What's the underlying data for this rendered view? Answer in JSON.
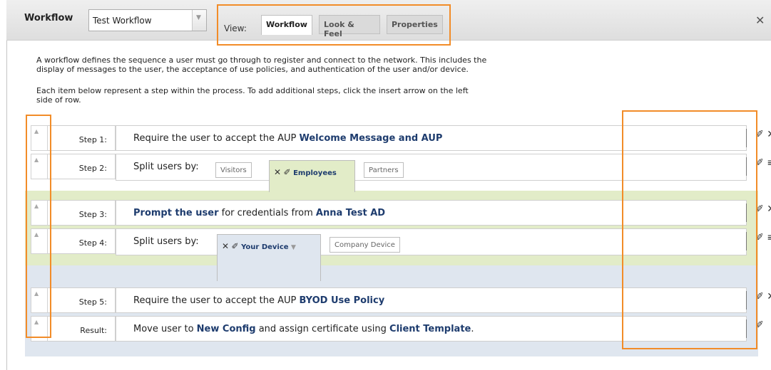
{
  "header": {
    "title": "Workflow",
    "selected_workflow": "Test Workflow",
    "view_label": "View:",
    "tabs": [
      {
        "label": "Workflow",
        "active": true
      },
      {
        "label": "Look & Feel",
        "active": false
      },
      {
        "label": "Properties",
        "active": false
      }
    ]
  },
  "description": {
    "line1": "A workflow defines the sequence a user must go through to register and connect to the network. This includes the",
    "line2": "display of messages to the user, the acceptance of use policies, and authentication of the user and/or device.",
    "line3": "Each item below represent a step within the process. To add additional steps, click the insert arrow on the left",
    "line4": "side of row."
  },
  "steps": [
    {
      "label": "Step 1:",
      "text": "Require the user to accept the AUP ",
      "bold": "Welcome Message and AUP"
    },
    {
      "label": "Step 2:",
      "text": "Split users by:",
      "splits": [
        "Visitors",
        "Employees",
        "Partners"
      ],
      "selected": "Employees"
    },
    {
      "label": "Step 3:",
      "bold1": "Prompt the user",
      "text": " for credentials from ",
      "bold2": "Anna Test AD"
    },
    {
      "label": "Step 4:",
      "text": "Split users by:",
      "splits": [
        "Your Device",
        "Company Device"
      ],
      "selected": "Your Device"
    },
    {
      "label": "Step 5:",
      "text": "Require the user to accept the AUP ",
      "bold": "BYOD Use Policy"
    },
    {
      "label": "Result:",
      "text1": "Move user to ",
      "bold1": "New Config",
      "text2": " and assign certificate using ",
      "bold2": "Client Template",
      "text3": "."
    }
  ],
  "icons": {
    "edit": "✐",
    "list": "≡",
    "delete": "✕",
    "search": "⚲",
    "play": "▶",
    "insert": "▲",
    "dropdown": "▼",
    "filter": "▼",
    "close": "✕"
  },
  "colors": {
    "highlight_border": "#f28c28",
    "employees_band": "#e2ecc8",
    "device_band": "#dfe6ef",
    "bold_text": "#1e3c6e"
  }
}
